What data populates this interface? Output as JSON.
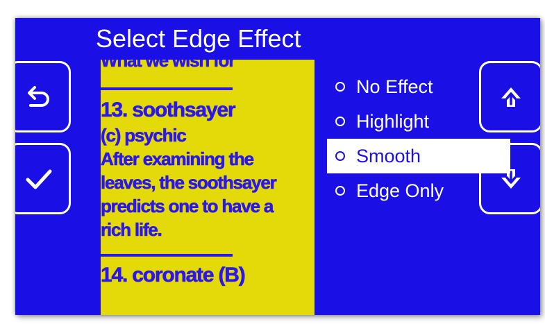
{
  "dialog": {
    "title": "Select Edge Effect"
  },
  "left_buttons": [
    {
      "icon": "back-arrow-icon"
    },
    {
      "icon": "checkmark-icon"
    }
  ],
  "right_buttons": [
    {
      "icon": "arrow-up-icon"
    },
    {
      "icon": "arrow-down-icon"
    }
  ],
  "preview": {
    "top_line": "What we wish for",
    "heading": "13. soothsayer",
    "lines": [
      "(c) psychic",
      "After examining the",
      "leaves, the soothsayer",
      "predicts one to have a",
      "rich life."
    ],
    "next_heading": "14. coronate (B)"
  },
  "options": [
    {
      "label": "No Effect",
      "selected": false
    },
    {
      "label": "Highlight",
      "selected": false
    },
    {
      "label": "Smooth",
      "selected": true
    },
    {
      "label": "Edge Only",
      "selected": false
    }
  ],
  "colors": {
    "background": "#1a10e6",
    "preview_background": "#e4da0a",
    "preview_text": "#2a17e8",
    "foreground": "#ffffff"
  }
}
